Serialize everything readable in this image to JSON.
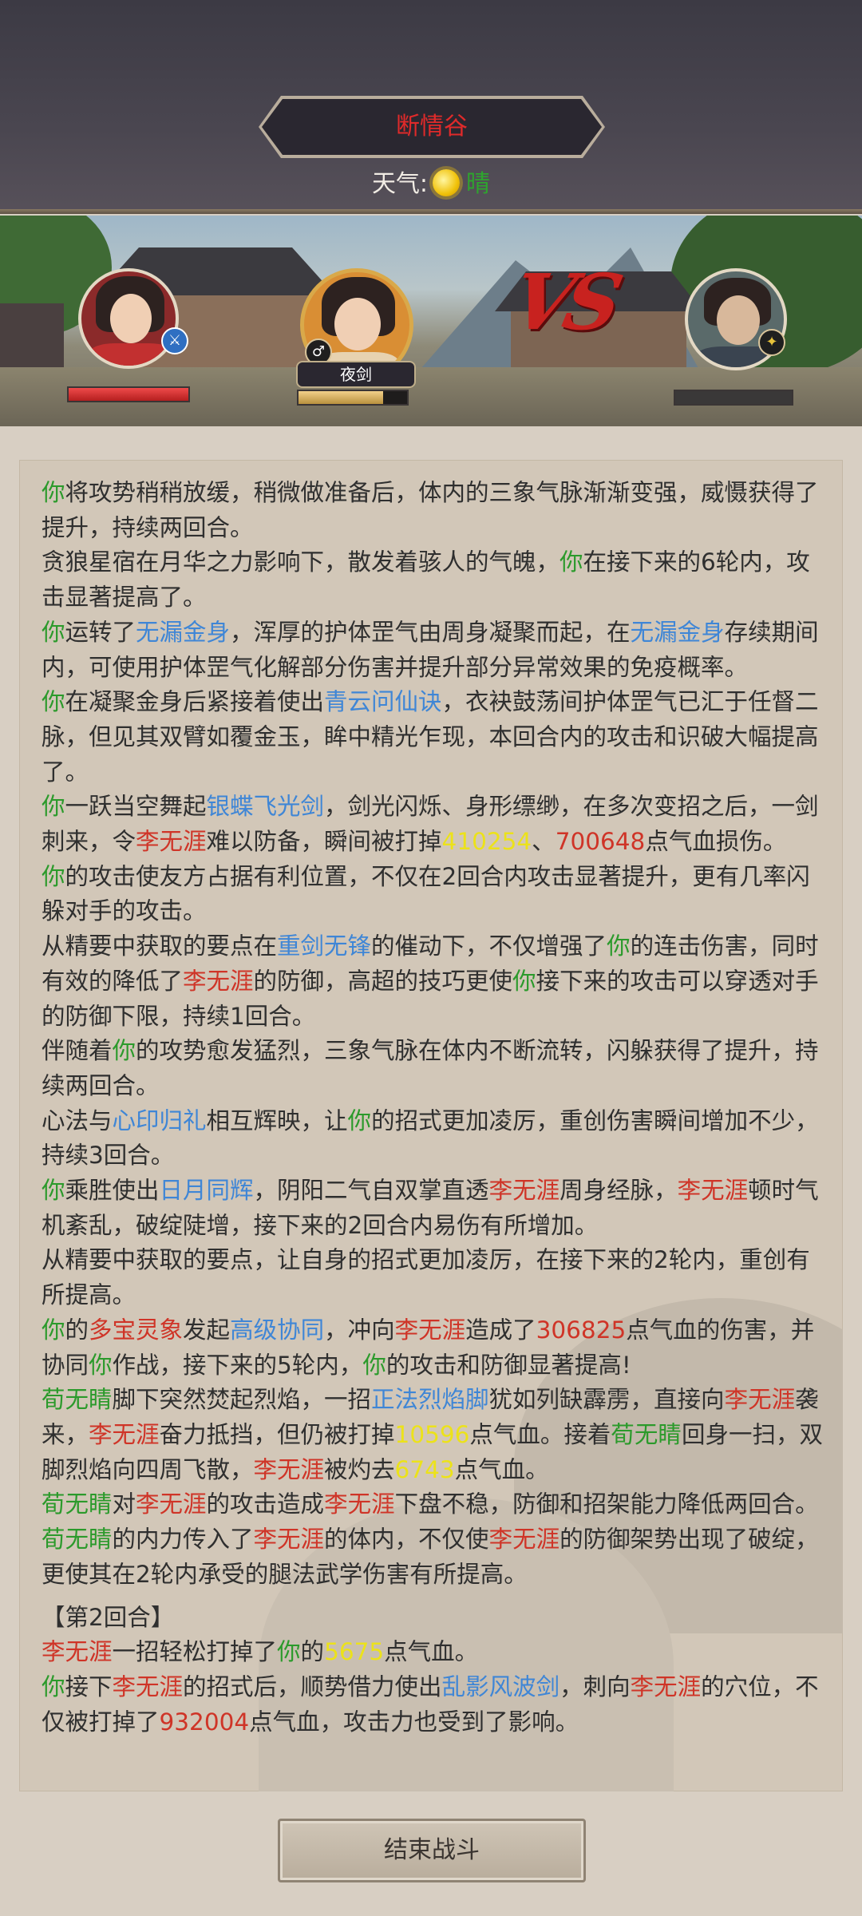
{
  "header": {
    "location": "断情谷",
    "weather_label": "天气:",
    "weather_value": "晴"
  },
  "scene": {
    "player_name": "夜剑",
    "vs_text": "VS"
  },
  "log": {
    "p1": {
      "t1": "你",
      "t2": "将攻势稍稍放缓，稍微做准备后，体内的三象气脉渐渐变强，威慑获得了提升，持续两回合。"
    },
    "p2": {
      "t1": "贪狼星宿在月华之力影响下，散发着骇人的气魄，",
      "t2": "你",
      "t3": "在接下来的6轮内，攻击显著提高了。"
    },
    "p3": {
      "t1": "你",
      "t2": "运转了",
      "t3": "无漏金身",
      "t4": "，浑厚的护体罡气由周身凝聚而起，在",
      "t5": "无漏金身",
      "t6": "存续期间内，可使用护体罡气化解部分伤害并提升部分异常效果的免疫概率。"
    },
    "p4": {
      "t1": "你",
      "t2": "在凝聚金身后紧接着使出",
      "t3": "青云问仙诀",
      "t4": "，衣袂鼓荡间护体罡气已汇于任督二脉，但见其双臂如覆金玉，眸中精光乍现，本回合内的攻击和识破大幅提高了。"
    },
    "p5": {
      "t1": "你",
      "t2": "一跃当空舞起",
      "t3": "银蝶飞光剑",
      "t4": "，剑光闪烁、身形缥缈，在多次变招之后，一剑刺来，令",
      "t5": "李无涯",
      "t6": "难以防备，瞬间被打掉",
      "t7": "410254",
      "t8": "、",
      "t9": "700648",
      "t10": "点气血损伤。"
    },
    "p6": {
      "t1": "你",
      "t2": "的攻击使友方占据有利位置，不仅在2回合内攻击显著提升，更有几率闪躲对手的攻击。"
    },
    "p7": {
      "t1": "从精要中获取的要点在",
      "t2": "重剑无锋",
      "t3": "的催动下，不仅增强了",
      "t4": "你",
      "t5": "的连击伤害，同时有效的降低了",
      "t6": "李无涯",
      "t7": "的防御，高超的技巧更使",
      "t8": "你",
      "t9": "接下来的攻击可以穿透对手的防御下限，持续1回合。"
    },
    "p8": {
      "t1": "伴随着",
      "t2": "你",
      "t3": "的攻势愈发猛烈，三象气脉在体内不断流转，闪躲获得了提升，持续两回合。"
    },
    "p9": {
      "t1": "心法与",
      "t2": "心印归礼",
      "t3": "相互辉映，让",
      "t4": "你",
      "t5": "的招式更加凌厉，重创伤害瞬间增加不少，持续3回合。"
    },
    "p10": {
      "t1": "你",
      "t2": "乘胜使出",
      "t3": "日月同辉",
      "t4": "，阴阳二气自双掌直透",
      "t5": "李无涯",
      "t6": "周身经脉，",
      "t7": "李无涯",
      "t8": "顿时气机紊乱，破绽陡增，接下来的2回合内易伤有所增加。"
    },
    "p11": {
      "t1": "从精要中获取的要点，让自身的招式更加凌厉，在接下来的2轮内，重创有所提高。"
    },
    "p12": {
      "t1": "你",
      "t2": "的",
      "t3": "多宝灵象",
      "t4": "发起",
      "t5": "高级协同",
      "t6": "，冲向",
      "t7": "李无涯",
      "t8": "造成了",
      "t9": "306825",
      "t10": "点气血的伤害，并协同",
      "t11": "你",
      "t12": "作战，接下来的5轮内，",
      "t13": "你",
      "t14": "的攻击和防御显著提高!"
    },
    "p13": {
      "t1": "荀无睛",
      "t2": "脚下突然焚起烈焰，一招",
      "t3": "正法烈焰脚",
      "t4": "犹如列缺霹雳，直接向",
      "t5": "李无涯",
      "t6": "袭来，",
      "t7": "李无涯",
      "t8": "奋力抵挡，但仍被打掉",
      "t9": "10596",
      "t10": "点气血。接着",
      "t11": "荀无睛",
      "t12": "回身一扫，双脚烈焰向四周飞散，",
      "t13": "李无涯",
      "t14": "被灼去",
      "t15": "6743",
      "t16": "点气血。"
    },
    "p14": {
      "t1": "荀无睛",
      "t2": "对",
      "t3": "李无涯",
      "t4": "的攻击造成",
      "t5": "李无涯",
      "t6": "下盘不稳，防御和招架能力降低两回合。"
    },
    "p15": {
      "t1": "荀无睛",
      "t2": "的内力传入了",
      "t3": "李无涯",
      "t4": "的体内，不仅使",
      "t5": "李无涯",
      "t6": "的防御架势出现了破绽，更使其在2轮内承受的腿法武学伤害有所提高。"
    },
    "round2": "【第2回合】",
    "p16": {
      "t1": "李无涯",
      "t2": "一招轻松打掉了",
      "t3": "你",
      "t4": "的",
      "t5": "5675",
      "t6": "点气血。"
    },
    "p17": {
      "t1": "你",
      "t2": "接下",
      "t3": "李无涯",
      "t4": "的招式后，顺势借力使出",
      "t5": "乱影风波剑",
      "t6": "，刺向",
      "t7": "李无涯",
      "t8": "的穴位，不仅被打掉了",
      "t9": "932004",
      "t10": "点气血，攻击力也受到了影响。"
    }
  },
  "actions": {
    "end_battle": "结束战斗"
  },
  "colors": {
    "self": "#2b9a2b",
    "skill": "#3f86d6",
    "enemy": "#cf3427",
    "damage": "#ece21a"
  }
}
